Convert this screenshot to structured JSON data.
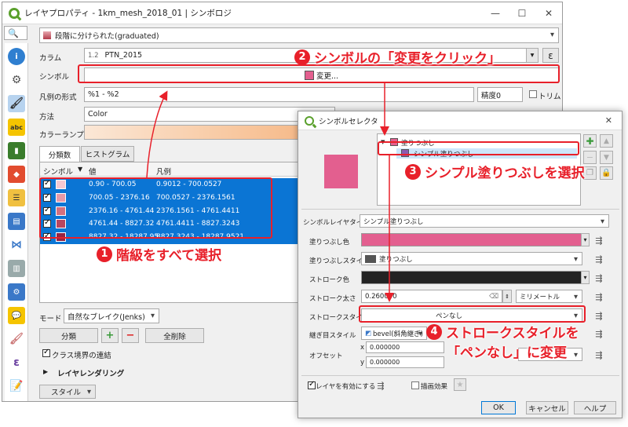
{
  "main": {
    "title": "レイヤプロパティ - 1km_mesh_2018_01 | シンボロジ",
    "win_min": "—",
    "win_max": "☐",
    "win_close": "✕",
    "renderer": "段階に分けられた(graduated)",
    "column_label": "カラム",
    "column_type": "1.2",
    "column_value": "PTN_2015",
    "epsilon": "ε",
    "symbol_label": "シンボル",
    "symbol_value": "変更...",
    "legend_format_label": "凡例の形式",
    "legend_format_value": "%1 - %2",
    "precision_label": "精度0",
    "trim_label": "トリム",
    "method_label": "方法",
    "method_value": "Color",
    "color_ramp_label": "カラーランプ",
    "tab_classes": "分類数",
    "tab_histogram": "ヒストグラム",
    "table_headers": {
      "symbol": "シンボル",
      "value": "値",
      "legend": "凡例"
    },
    "rows": [
      {
        "value": "0.90 - 700.05",
        "legend": "0.9012 - 700.0527",
        "color": "#f6c9d2"
      },
      {
        "value": "700.05 - 2376.16",
        "legend": "700.0527 - 2376.1561",
        "color": "#e89aa8"
      },
      {
        "value": "2376.16 - 4761.44",
        "legend": "2376.1561 - 4761.4411",
        "color": "#d4707f"
      },
      {
        "value": "4761.44 - 8827.32",
        "legend": "4761.4411 - 8827.3243",
        "color": "#b94660"
      },
      {
        "value": "8827.32 - 18287.95",
        "legend": "8827.3243 - 18287.9521",
        "color": "#952543"
      }
    ],
    "mode_label": "モード",
    "mode_value": "自然なブレイク(Jenks)",
    "classify_btn": "分類",
    "add_btn": "+",
    "remove_btn": "−",
    "delete_all_btn": "全削除",
    "link_class_label": "クラス境界の連結",
    "layer_rendering": "レイヤレンダリング",
    "style_btn": "スタイル"
  },
  "selector": {
    "title": "シンボルセレクタ",
    "close": "✕",
    "tree_fill": "塗りつぶし",
    "tree_simple_fill": "シンプル塗りつぶし",
    "preview_color": "#e35f8f",
    "layer_type_label": "シンボルレイヤタイプ",
    "layer_type_value": "シンプル塗りつぶし",
    "fill_color_label": "塗りつぶし色",
    "fill_color": "#e35f8f",
    "fill_style_label": "塗りつぶしスタイル",
    "fill_style_value": "塗りつぶし",
    "stroke_color_label": "ストローク色",
    "stroke_color": "#232323",
    "stroke_width_label": "ストローク太さ",
    "stroke_width_value": "0.260000",
    "stroke_unit": "ミリメートル",
    "stroke_style_label": "ストロークスタイル",
    "stroke_style_value": "ペンなし",
    "join_style_label": "継ぎ目スタイル",
    "join_style_value": "bevel(斜角継ぎ)",
    "offset_label": "オフセット",
    "offset_x_label": "x",
    "offset_x": "0.000000",
    "offset_y_label": "y",
    "offset_y": "0.000000",
    "enable_layer": "レイヤを有効にする",
    "draw_effects": "描画効果",
    "ok": "OK",
    "cancel": "キャンセル",
    "help": "ヘルプ"
  },
  "annotations": {
    "a1": "階級をすべて選択",
    "a2": "シンボルの「変更をクリック」",
    "a3": "シンプル塗りつぶしを選択",
    "a4_line1": "ストロークスタイルを",
    "a4_line2": "「ペンなし」に変更",
    "n1": "1",
    "n2": "2",
    "n3": "3",
    "n4": "4"
  },
  "colors": {
    "accent_red": "#e8202a",
    "selection_blue": "#0b75d4"
  }
}
